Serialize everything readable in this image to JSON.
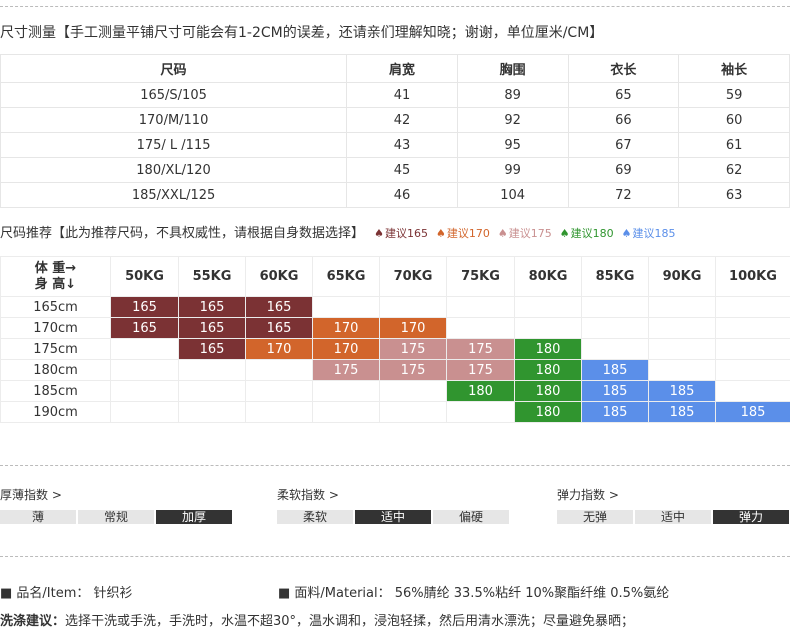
{
  "title": "尺寸测量【手工测量平铺尺寸可能会有1-2CM的误差，还请亲们理解知晓；谢谢，单位厘米/CM】",
  "size_table": {
    "headers": [
      "尺码",
      "肩宽",
      "胸围",
      "衣长",
      "袖长"
    ],
    "rows": [
      [
        "165/S/105",
        "41",
        "89",
        "65",
        "59"
      ],
      [
        "170/M/110",
        "42",
        "92",
        "66",
        "60"
      ],
      [
        "175/ L /115",
        "43",
        "95",
        "67",
        "61"
      ],
      [
        "180/XL/120",
        "45",
        "99",
        "69",
        "62"
      ],
      [
        "185/XXL/125",
        "46",
        "104",
        "72",
        "63"
      ]
    ]
  },
  "recommend": {
    "title": "尺码推荐【此为推荐尺码，不具权威性，请根据自身数据选择】",
    "legend": [
      {
        "label": "建议165",
        "color": "#7b3234"
      },
      {
        "label": "建议170",
        "color": "#d2652b"
      },
      {
        "label": "建议175",
        "color": "#c99090"
      },
      {
        "label": "建议180",
        "color": "#30952f"
      },
      {
        "label": "建议185",
        "color": "#5b8fe9"
      }
    ],
    "corner_top": "体 重→",
    "corner_bottom": "身 高↓",
    "weights": [
      "50KG",
      "55KG",
      "60KG",
      "65KG",
      "70KG",
      "75KG",
      "80KG",
      "85KG",
      "90KG",
      "100KG"
    ],
    "heights": [
      "165cm",
      "170cm",
      "175cm",
      "180cm",
      "185cm",
      "190cm"
    ],
    "cells": [
      [
        "165",
        "165",
        "165",
        "",
        "",
        "",
        "",
        "",
        "",
        ""
      ],
      [
        "165",
        "165",
        "165",
        "170",
        "170",
        "",
        "",
        "",
        "",
        ""
      ],
      [
        "",
        "165",
        "170",
        "170",
        "175",
        "175",
        "180",
        "",
        "",
        ""
      ],
      [
        "",
        "",
        "",
        "175",
        "175",
        "175",
        "180",
        "185",
        "",
        ""
      ],
      [
        "",
        "",
        "",
        "",
        "",
        "180",
        "180",
        "185",
        "185",
        ""
      ],
      [
        "",
        "",
        "",
        "",
        "",
        "",
        "180",
        "185",
        "185",
        "185"
      ]
    ],
    "colors": {
      "165": "#7b3234",
      "170": "#d2652b",
      "175": "#c99090",
      "180": "#30952f",
      "185": "#5b8fe9"
    }
  },
  "thickness": {
    "label": "厚薄指数 >",
    "options": [
      "薄",
      "常规",
      "加厚"
    ],
    "selected": 2
  },
  "softness": {
    "label": "柔软指数 >",
    "options": [
      "柔软",
      "适中",
      "偏硬"
    ],
    "selected": 1
  },
  "elasticity": {
    "label": "弹力指数 >",
    "options": [
      "无弹",
      "适中",
      "弹力"
    ],
    "selected": 2
  },
  "item": "■ 品名/Item： 针织衫",
  "material": "■ 面料/Material： 56%腈纶 33.5%粘纤 10%聚酯纤维 0.5%氨纶",
  "care_label": "洗涤建议：",
  "care_text": "选择干洗或手洗，手洗时，水温不超30°，温水调和，浸泡轻揉，然后用清水漂洗；尽量避免暴晒；"
}
